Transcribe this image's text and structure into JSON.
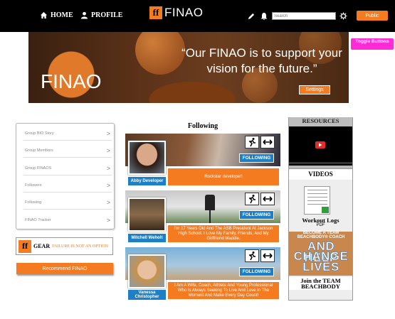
{
  "nav": {
    "home_label": "HOME",
    "profile_label": "PROFILE",
    "logo_text": "FINAO",
    "search_placeholder": "Search",
    "public_label": "Public",
    "icons": [
      "home-icon",
      "person-icon",
      "pencil-icon",
      "bell-icon",
      "gear-icon"
    ]
  },
  "toggle": {
    "label": "Toggle Buttons"
  },
  "banner": {
    "brand": "FINAO",
    "quote": "“Our FINAO is to support your vision for the future.”",
    "settings_label": "Settings"
  },
  "sidebar": {
    "items": [
      {
        "label": "Group BIO Story"
      },
      {
        "label": "Group Members"
      },
      {
        "label": "Group FINAOS"
      },
      {
        "label": "Followers"
      },
      {
        "label": "Following"
      },
      {
        "label": "FINAO Tracker"
      }
    ],
    "gear": {
      "brand": "GEAR",
      "tagline": "FAILURE IS NOT AN OPTION"
    },
    "recommend_label": "Recommend FINAO"
  },
  "following": {
    "title": "Following",
    "cards": [
      {
        "name": "Abby Developer",
        "bio": "Rockstar developer!",
        "follow_label": "FOLLOWING"
      },
      {
        "name": "Mitchell Weholt",
        "bio": "I'm 17 Years Old And The ASB President At Jackson High School. I Love My Family, Friends, And My Girlfriend Maddie.",
        "follow_label": "FOLLOWING"
      },
      {
        "name": "Vanessa Christopher",
        "bio": "I Am A Wife, Coach, Athlete And Young Professional Who Is Always Seeking To Live And Love In The Moment And Make Every Day Count!",
        "follow_label": "FOLLOWING"
      }
    ]
  },
  "resources": {
    "title": "RESOURCES"
  },
  "videos": {
    "title": "VIDEOS",
    "workout_label": "Workout Logs",
    "workout_sub": "PDF",
    "promo_small": "BECOME A TEAM BEACHBODY® COACH",
    "promo_line1": "AND HELP",
    "promo_line2": "CHANGE",
    "promo_line3": "LIVES",
    "join_label": "Join the TEAM BEACHBODY"
  },
  "colors": {
    "accent": "#f47b20",
    "follow_blue": "#1f7fc6",
    "toggle_pink": "#ff2bd6",
    "nav_bg": "#000000"
  }
}
